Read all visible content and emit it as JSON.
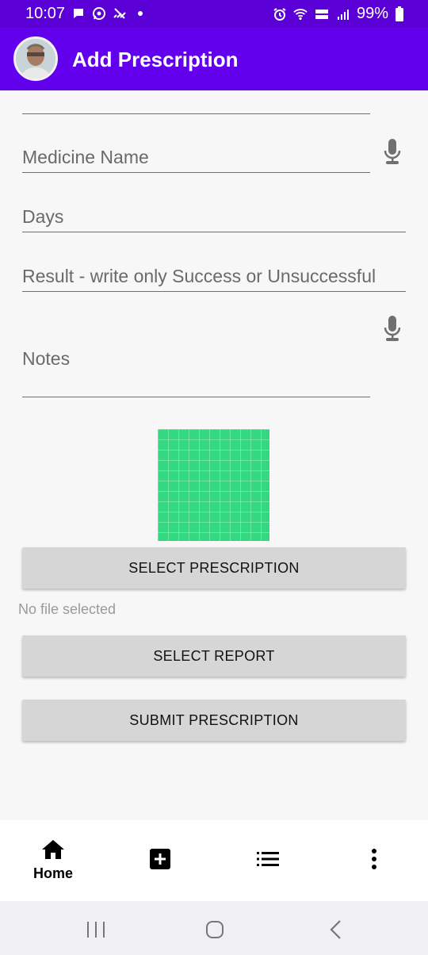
{
  "status_bar": {
    "time": "10:07",
    "battery": "99%",
    "left_icons": [
      "message-icon",
      "whatsapp-icon",
      "signal-slash-icon",
      "dot-icon"
    ],
    "right_icons": [
      "alarm-icon",
      "wifi-icon",
      "volte-icon",
      "signal-icon",
      "battery-icon"
    ]
  },
  "app_bar": {
    "title": "Add Prescription",
    "color": "#6200ee"
  },
  "form": {
    "top_field": {
      "value": ""
    },
    "medicine_name": {
      "placeholder": "Medicine Name"
    },
    "days": {
      "placeholder": "Days"
    },
    "result": {
      "placeholder": "Result - write only Success or Unsuccessful"
    },
    "notes": {
      "placeholder": "Notes"
    }
  },
  "buttons": {
    "select_prescription": "SELECT PRESCRIPTION",
    "select_report": "SELECT REPORT",
    "submit_prescription": "SUBMIT PRESCRIPTION"
  },
  "file_status": "No file selected",
  "bottom_nav": {
    "items": [
      {
        "icon": "home-icon",
        "label": "Home"
      },
      {
        "icon": "add-box-icon",
        "label": ""
      },
      {
        "icon": "list-icon",
        "label": ""
      },
      {
        "icon": "more-vert-icon",
        "label": ""
      }
    ]
  },
  "system_nav": {
    "icons": [
      "recents-icon",
      "home-circle-icon",
      "back-icon"
    ]
  }
}
